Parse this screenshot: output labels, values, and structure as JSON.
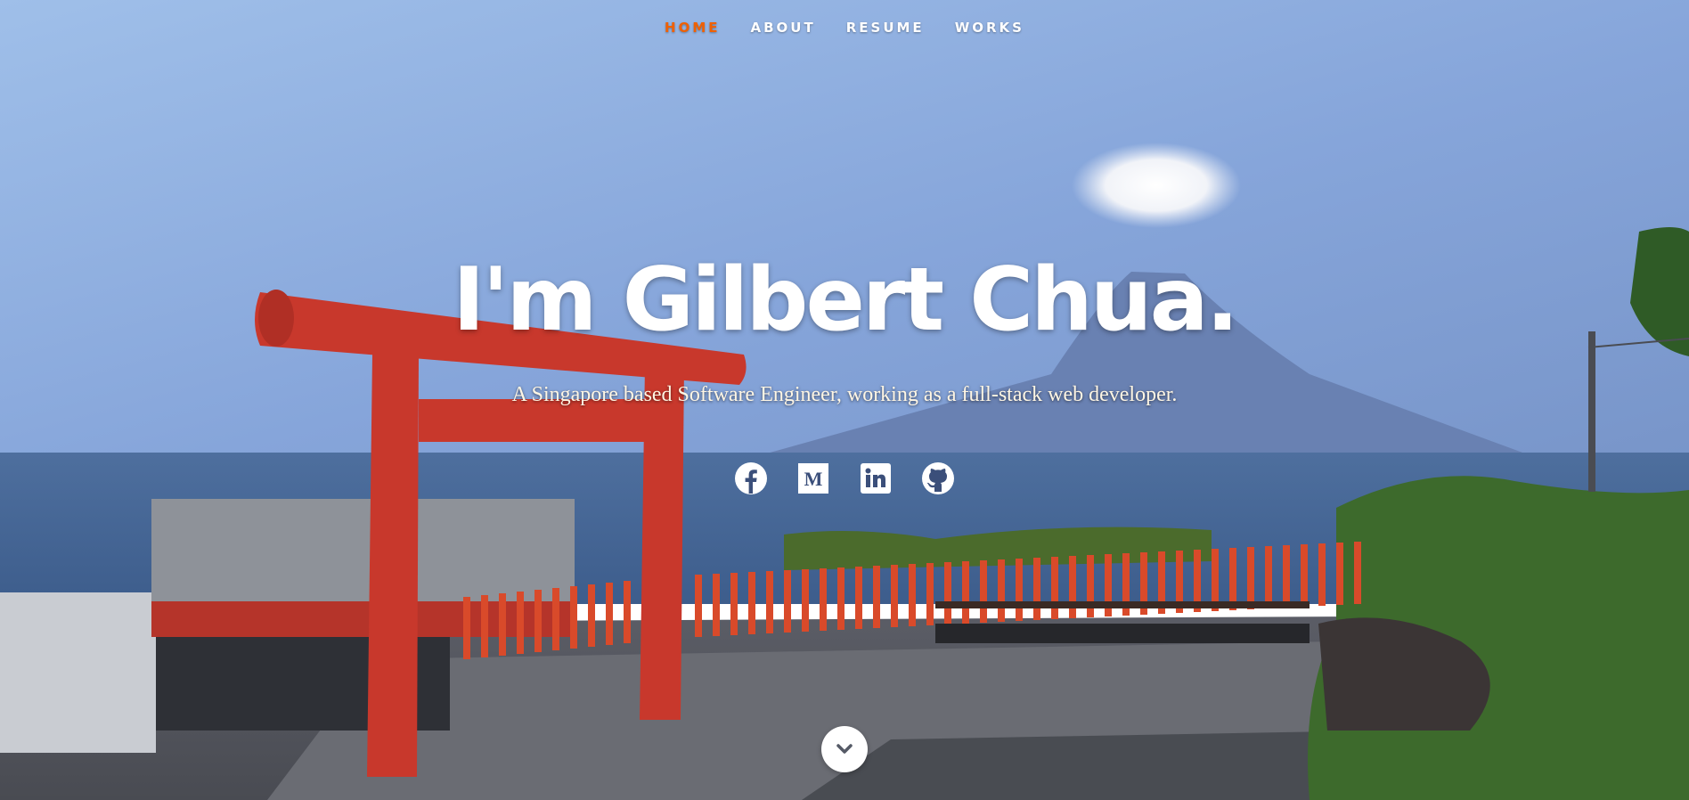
{
  "nav": {
    "items": [
      {
        "label": "HOME",
        "active": true
      },
      {
        "label": "ABOUT",
        "active": false
      },
      {
        "label": "RESUME",
        "active": false
      },
      {
        "label": "WORKS",
        "active": false
      }
    ],
    "active_color": "#f06000"
  },
  "hero": {
    "title": "I'm Gilbert Chua.",
    "subtitle": "A Singapore based Software Engineer, working as a full-stack web developer."
  },
  "social": {
    "icons": [
      "facebook-icon",
      "medium-icon",
      "linkedin-icon",
      "github-icon"
    ]
  },
  "scroll": {
    "icon": "chevron-down-icon"
  },
  "colors": {
    "accent": "#f06000",
    "torii": "#c8382c"
  }
}
